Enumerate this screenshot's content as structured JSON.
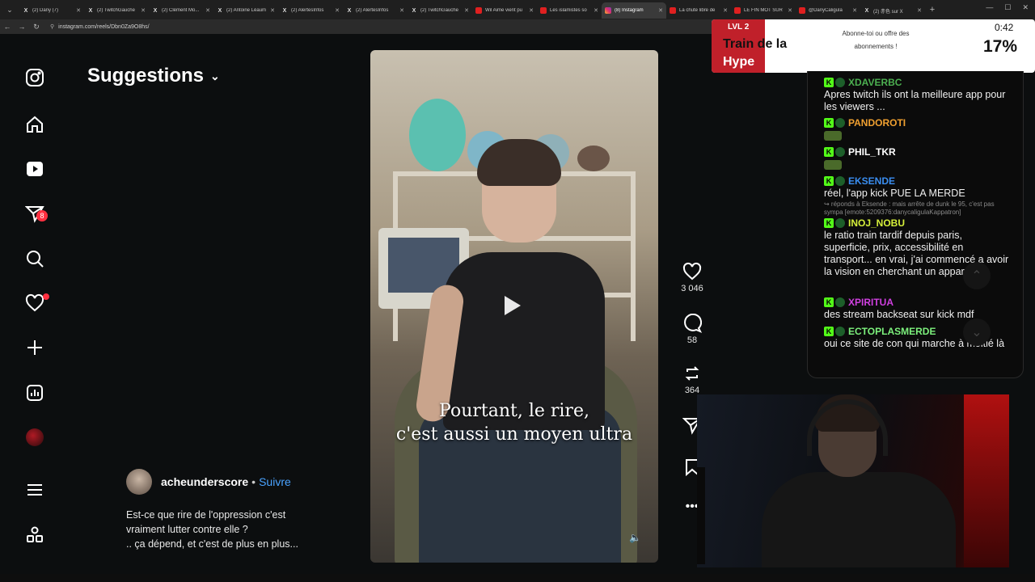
{
  "browser": {
    "tabs": [
      {
        "title": "(2) Dany (7)",
        "fav": "X",
        "kind": "x"
      },
      {
        "title": "(2) TwitchGauche",
        "fav": "X",
        "kind": "x"
      },
      {
        "title": "(2) Clément Mo...",
        "fav": "X",
        "kind": "x"
      },
      {
        "title": "(2) Antoine Léaum",
        "fav": "X",
        "kind": "x"
      },
      {
        "title": "(2) AlertesInfos",
        "fav": "X",
        "kind": "x"
      },
      {
        "title": "(2) AlertesInfos",
        "fav": "X",
        "kind": "x"
      },
      {
        "title": "(2) TwitchGauche",
        "fav": "X",
        "kind": "x"
      },
      {
        "title": "Wil Aime vient pu",
        "fav": "",
        "kind": "yt"
      },
      {
        "title": "Les islamistes so",
        "fav": "",
        "kind": "yt"
      },
      {
        "title": "(8) Instagram",
        "fav": "",
        "kind": "ig",
        "active": true
      },
      {
        "title": "La chute libre de",
        "fav": "",
        "kind": "yt"
      },
      {
        "title": "LE FIN MOT SUR",
        "fav": "",
        "kind": "yt"
      },
      {
        "title": "@DanyCaligula",
        "fav": "",
        "kind": "yt"
      },
      {
        "title": "(2) 赤色 sur X",
        "fav": "X",
        "kind": "x"
      }
    ],
    "url": "instagram.com/reels/Dbn0Za9O8hs/"
  },
  "instagram": {
    "sidebar": {
      "messages_badge": "8"
    },
    "section_title": "Suggestions",
    "reel": {
      "caption_line1": "Pourtant, le rire,",
      "caption_line2": "c'est aussi un moyen ultra",
      "likes": "3 046",
      "comments": "58",
      "reposts": "364",
      "author": "acheunderscore",
      "separator": "•",
      "follow_label": "Suivre",
      "description_line1": "Est-ce que rire de l'oppression c'est",
      "description_line2": "vraiment lutter contre elle ?",
      "description_line3": ".. ça dépend, et c'est de plus en plus..."
    }
  },
  "hype_train": {
    "level": "LVL 2",
    "title_part1": "Train de la",
    "title_part2": "Hype",
    "message": "Abonne-toi ou offre des abonnements !",
    "timer": "0:42",
    "percent": "17%",
    "accent": "#c0202a"
  },
  "chat": {
    "messages": [
      {
        "user": "XDAVERBC",
        "color": "#4caf50",
        "text": "Apres twitch ils ont la meilleure app pour les viewers ..."
      },
      {
        "user": "PANDOROTI",
        "color": "#f0a030",
        "text": ""
      },
      {
        "user": "PHIL_TKR",
        "color": "#ffffff",
        "text": ""
      },
      {
        "user": "EKSENDE",
        "color": "#3a8ef0",
        "text": "réel, l'app kick PUE LA MERDE"
      },
      {
        "user": "INOJ_NOBU",
        "color": "#d6f03a",
        "reply": "↪ réponds à Eksende : mais arrête de dunk le 95, c'est pas sympa [emote:5209376:danycaligulaKappatron]",
        "text": "le ratio train tardif depuis paris, superficie, prix, accessibilité en transport... en vrai, j'ai commencé a avoir la vision en cherchant un appart..."
      },
      {
        "user": "XPIRITUA",
        "color": "#d040e0",
        "text": "des stream backseat sur kick mdf"
      },
      {
        "user": "ECTOPLASMERDE",
        "color": "#7cf07c",
        "text": "oui ce site de con qui marche à moitié là"
      }
    ]
  }
}
